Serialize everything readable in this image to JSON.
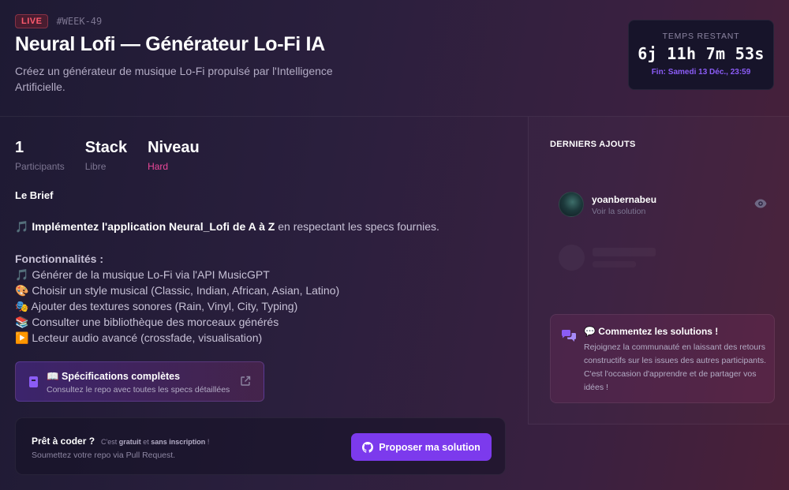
{
  "header": {
    "live_label": "LIVE",
    "week_tag": "#WEEK-49",
    "title": "Neural Lofi — Générateur Lo-Fi IA",
    "subtitle": "Créez un générateur de musique Lo-Fi propulsé par l'Intelligence Artificielle."
  },
  "timer": {
    "label": "TEMPS RESTANT",
    "value": "6j 11h 7m 53s",
    "end": "Fin: Samedi 13 Déc., 23:59"
  },
  "stats": [
    {
      "value": "1",
      "label": "Participants"
    },
    {
      "value": "Stack",
      "label": "Libre"
    },
    {
      "value": "Niveau",
      "label": "Hard"
    }
  ],
  "brief": {
    "title": "Le Brief",
    "intro_prefix": "🎵 ",
    "intro_bold": "Implémentez l'application Neural_Lofi de A à Z",
    "intro_rest": " en respectant les specs fournies.",
    "features_title": "Fonctionnalités :",
    "features": [
      "🎵 Générer de la musique Lo-Fi via l'API MusicGPT",
      "🎨 Choisir un style musical (Classic, Indian, African, Asian, Latino)",
      "🎭 Ajouter des textures sonores (Rain, Vinyl, City, Typing)",
      "📚 Consulter une bibliothèque des morceaux générés",
      "▶️ Lecteur audio avancé (crossfade, visualisation)"
    ]
  },
  "specs": {
    "title": "📖 Spécifications complètes",
    "desc": "Consultez le repo avec toutes les specs détaillées"
  },
  "cta": {
    "title": "Prêt à coder ?",
    "note_pre": "C'est ",
    "note_b1": "gratuit",
    "note_mid": " et ",
    "note_b2": "sans inscription",
    "note_post": " !",
    "desc": "Soumettez votre repo via Pull Request.",
    "button": "Proposer ma solution"
  },
  "sidebar": {
    "title": "DERNIERS AJOUTS",
    "entry": {
      "name": "yoanbernabeu",
      "sub": "Voir la solution"
    },
    "comment_title": "💬 Commentez les solutions !",
    "comment_text": "Rejoignez la communauté en laissant des retours constructifs sur les issues des autres participants. C'est l'occasion d'apprendre et de partager vos idées !"
  },
  "colors": {
    "accent": "#7c3aed",
    "live": "#ff5a6e",
    "hard": "#ec4899"
  }
}
